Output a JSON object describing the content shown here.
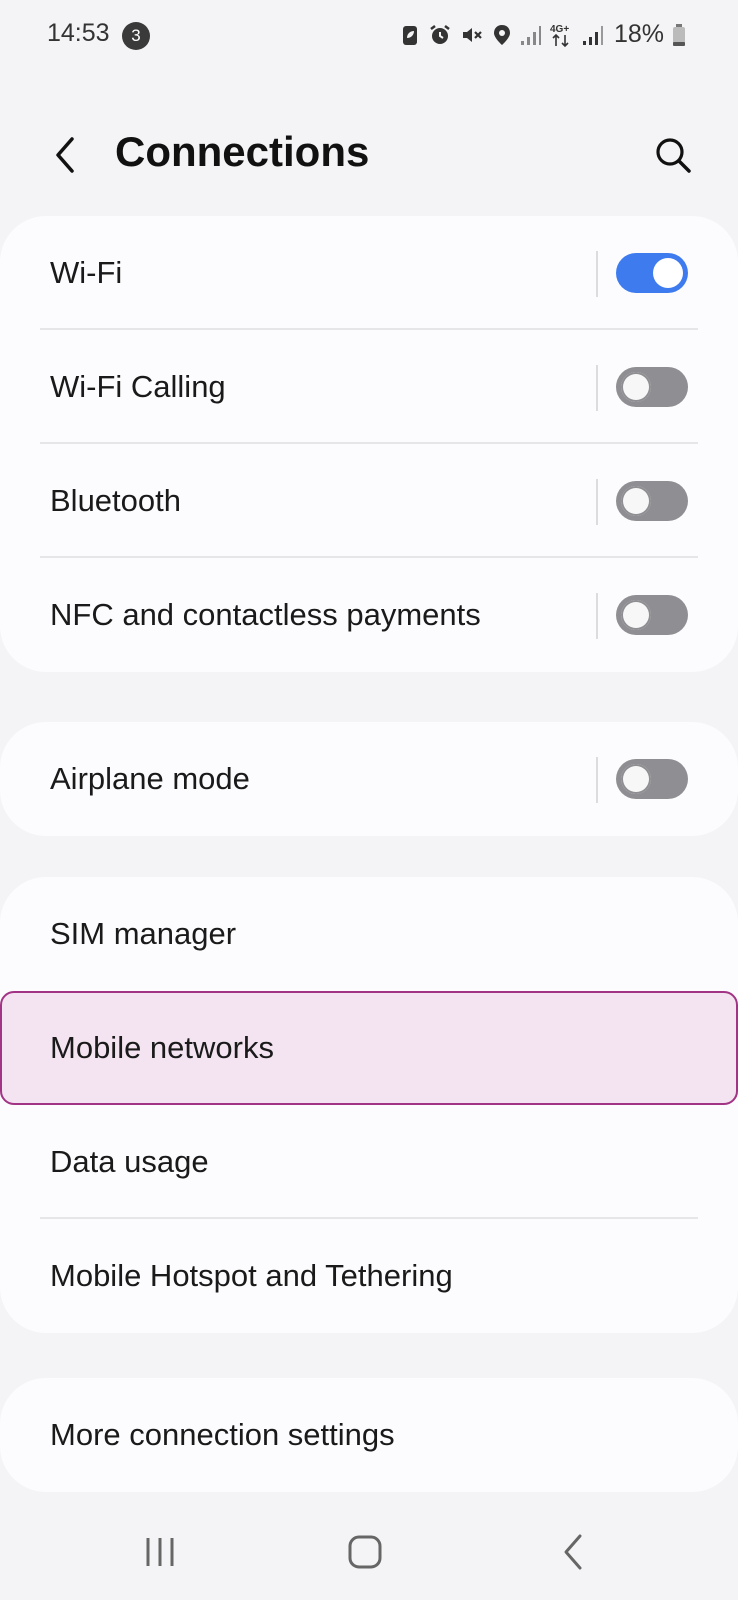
{
  "status_bar": {
    "time": "14:53",
    "notification_count": "3",
    "battery": "18%",
    "network_type": "4G+"
  },
  "header": {
    "title": "Connections"
  },
  "groups": [
    {
      "items": [
        {
          "label": "Wi-Fi",
          "toggle": true,
          "state": "on"
        },
        {
          "label": "Wi-Fi Calling",
          "toggle": true,
          "state": "off"
        },
        {
          "label": "Bluetooth",
          "toggle": true,
          "state": "off"
        },
        {
          "label": "NFC and contactless payments",
          "toggle": true,
          "state": "off"
        }
      ]
    },
    {
      "items": [
        {
          "label": "Airplane mode",
          "toggle": true,
          "state": "off"
        }
      ]
    },
    {
      "items": [
        {
          "label": "SIM manager"
        },
        {
          "label": "Mobile networks",
          "highlighted": true
        },
        {
          "label": "Data usage"
        },
        {
          "label": "Mobile Hotspot and Tethering"
        }
      ]
    },
    {
      "items": [
        {
          "label": "More connection settings"
        }
      ]
    }
  ],
  "colors": {
    "toggle_on": "#3e7bef",
    "toggle_off": "#8f8f93",
    "highlight_bg": "#f4e3f0",
    "highlight_border": "#a23485",
    "background": "#f4f4f6"
  },
  "icons": {
    "back": "chevron-left-icon",
    "search": "search-icon",
    "nav_recents": "recents-icon",
    "nav_home": "home-icon",
    "nav_back": "back-icon"
  }
}
